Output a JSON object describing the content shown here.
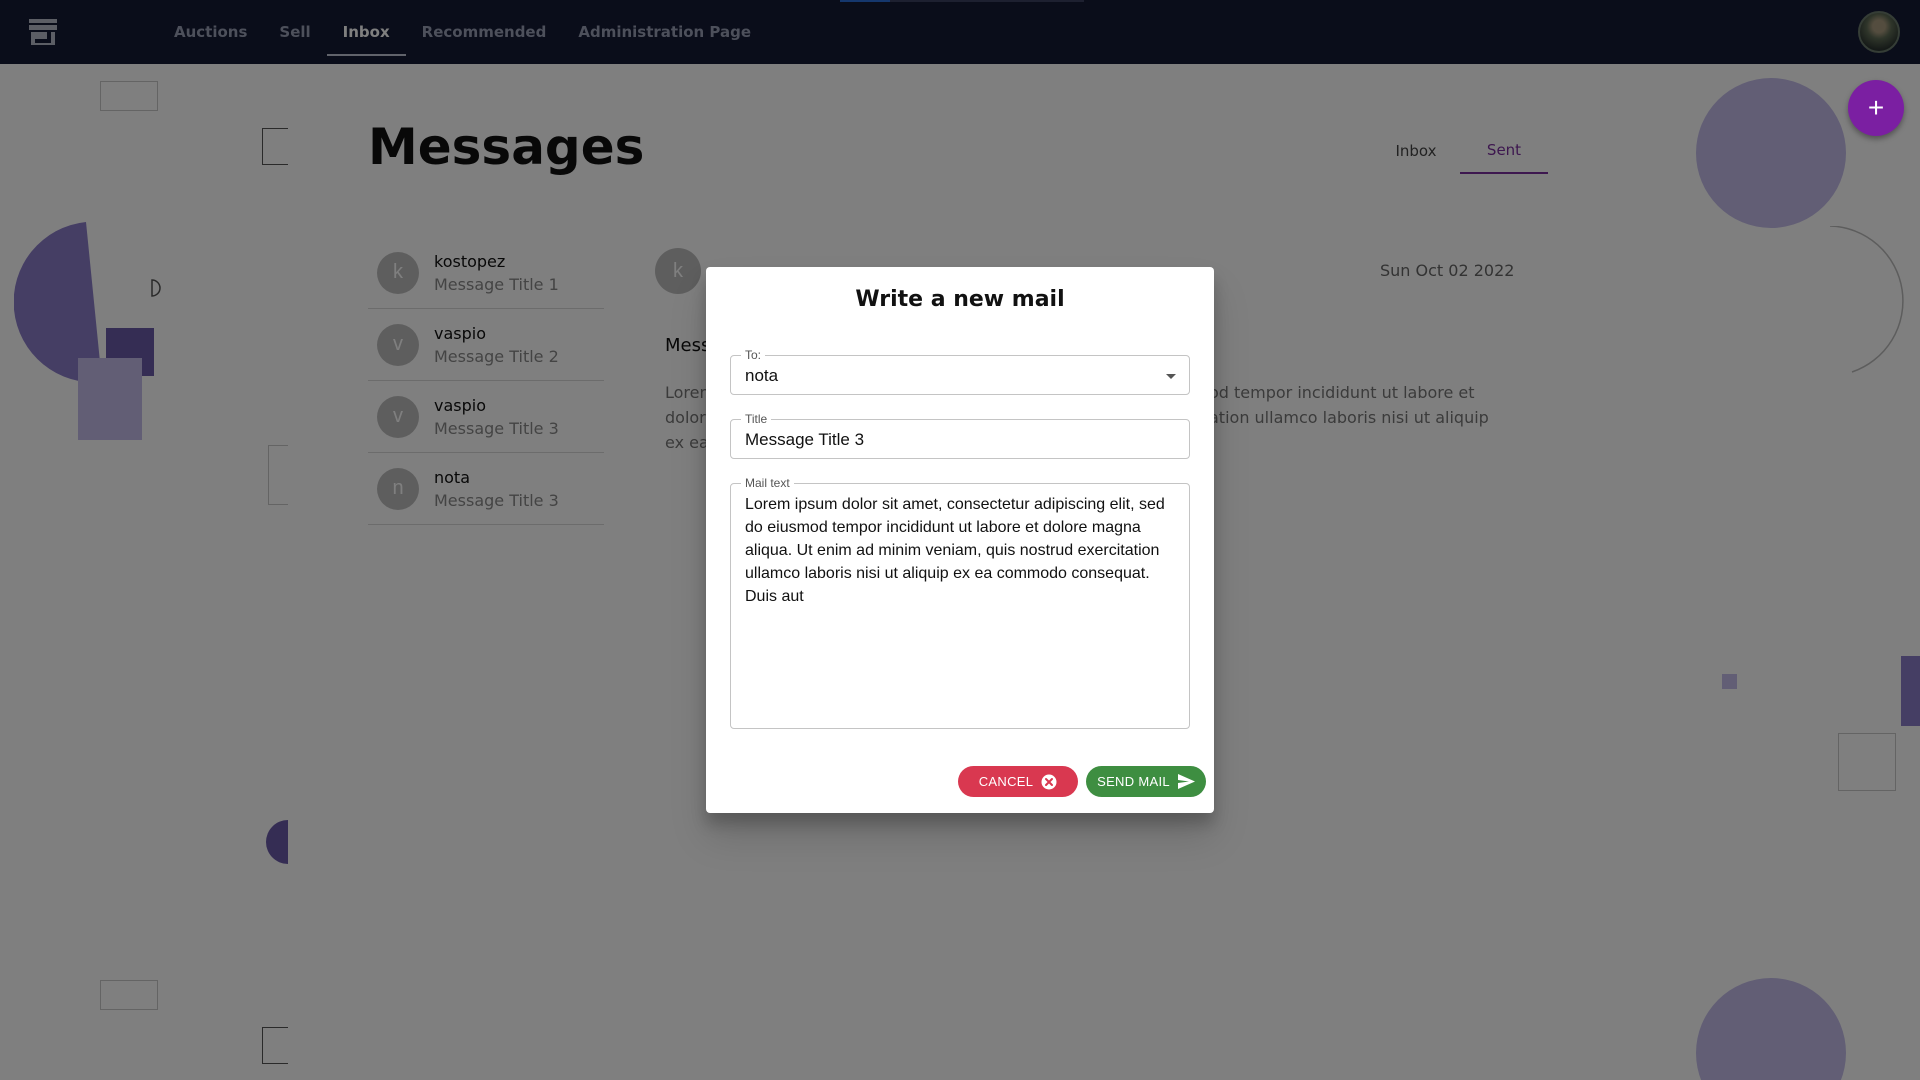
{
  "navbar": {
    "items": [
      {
        "label": "Auctions"
      },
      {
        "label": "Sell"
      },
      {
        "label": "Inbox",
        "active": true
      },
      {
        "label": "Recommended"
      },
      {
        "label": "Administration Page"
      }
    ]
  },
  "page": {
    "title": "Messages",
    "tabs": [
      {
        "label": "Inbox"
      },
      {
        "label": "Sent",
        "active": true
      }
    ]
  },
  "messages": [
    {
      "initial": "k",
      "sender": "kostopez",
      "title": "Message Title 1"
    },
    {
      "initial": "v",
      "sender": "vaspio",
      "title": "Message Title 2"
    },
    {
      "initial": "v",
      "sender": "vaspio",
      "title": "Message Title 3"
    },
    {
      "initial": "n",
      "sender": "nota",
      "title": "Message Title 3"
    }
  ],
  "detail": {
    "initial": "k",
    "date": "Sun Oct 02 2022",
    "title_partial": "Mess",
    "body_left": "Lorem\ndolor\nex ea",
    "body_right": "od tempor incididunt ut labore et\nation ullamco laboris nisi ut aliquip"
  },
  "fab": {
    "icon": "plus-icon",
    "label": "+"
  },
  "dialog": {
    "title": "Write a new mail",
    "to": {
      "label": "To:",
      "value": "nota"
    },
    "title_field": {
      "label": "Title",
      "value": "Message Title 3"
    },
    "mail_text": {
      "label": "Mail text",
      "value": "Lorem ipsum dolor sit amet, consectetur adipiscing elit, sed do eiusmod tempor incididunt ut labore et dolore magna aliqua. Ut enim ad minim veniam, quis nostrud exercitation ullamco laboris nisi ut aliquip ex ea commodo consequat. Duis aut"
    },
    "cancel_label": "CANCEL",
    "send_label": "SEND MAIL"
  },
  "colors": {
    "navbar": "#141a35",
    "accent": "#7b2e9e",
    "cancel": "#d93850",
    "send": "#3e8e41"
  }
}
